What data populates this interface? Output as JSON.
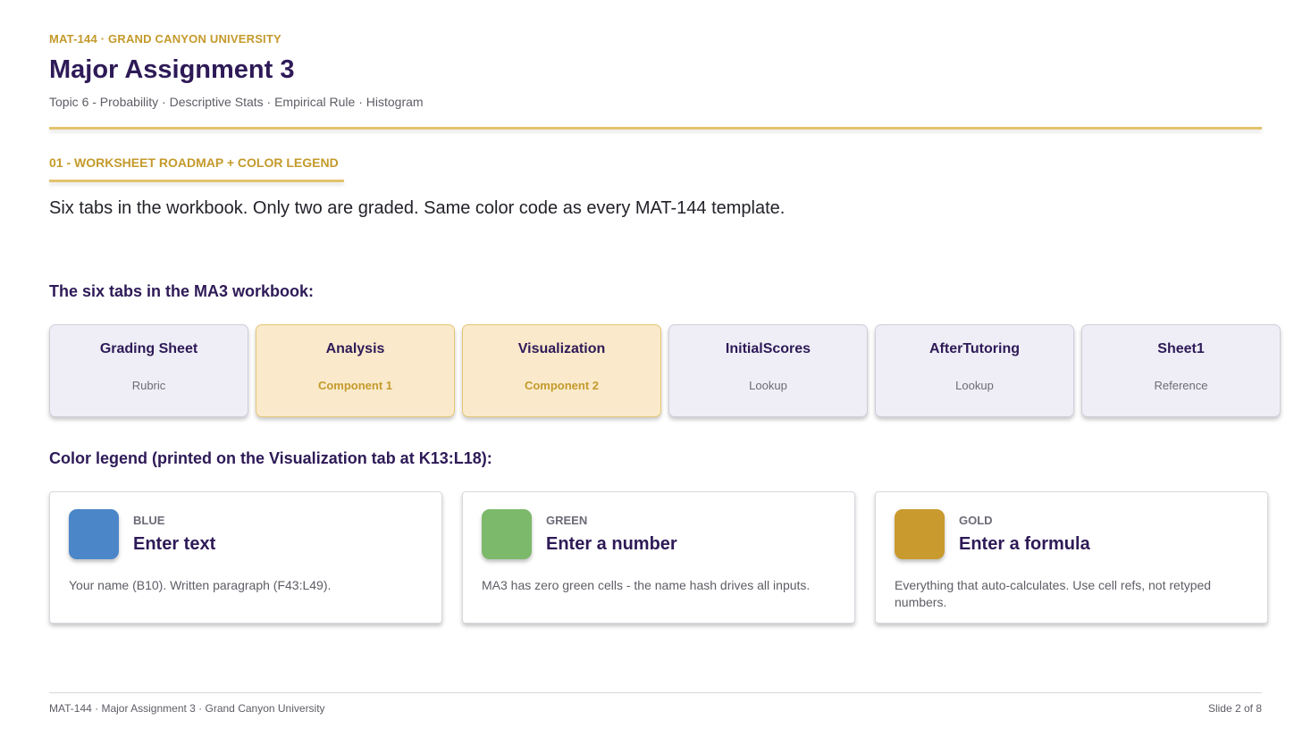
{
  "header": {
    "eyebrow": "MAT-144 · GRAND CANYON UNIVERSITY",
    "title": "Major Assignment 3",
    "subtitle": "Topic 6 - Probability · Descriptive Stats · Empirical Rule · Histogram"
  },
  "section": {
    "label": "01 - WORKSHEET ROADMAP + COLOR LEGEND",
    "lead": "Six tabs in the workbook. Only two are graded. Same color code as every MAT-144 template."
  },
  "tabs_heading": "The six tabs in the MA3 workbook:",
  "tabs": [
    {
      "name": "Grading Sheet",
      "role": "Rubric"
    },
    {
      "name": "Analysis",
      "role": "Component 1"
    },
    {
      "name": "Visualization",
      "role": "Component 2"
    },
    {
      "name": "InitialScores",
      "role": "Lookup"
    },
    {
      "name": "AfterTutoring",
      "role": "Lookup"
    },
    {
      "name": "Sheet1",
      "role": "Reference"
    }
  ],
  "legend_heading": "Color legend (printed on the Visualization tab at K13:L18):",
  "legend": [
    {
      "key": "BLUE",
      "action": "Enter text",
      "desc": "Your name (B10). Written paragraph (F43:L49).",
      "color": "#4a86c8"
    },
    {
      "key": "GREEN",
      "action": "Enter a number",
      "desc": "MA3 has zero green cells - the name hash drives all inputs.",
      "color": "#7cb96a"
    },
    {
      "key": "GOLD",
      "action": "Enter a formula",
      "desc": "Everything that auto-calculates. Use cell refs, not retyped numbers.",
      "color": "#c99a2e"
    }
  ],
  "footer": {
    "left": "MAT-144 · Major Assignment 3 · Grand Canyon University",
    "right": "Slide 2 of 8"
  }
}
